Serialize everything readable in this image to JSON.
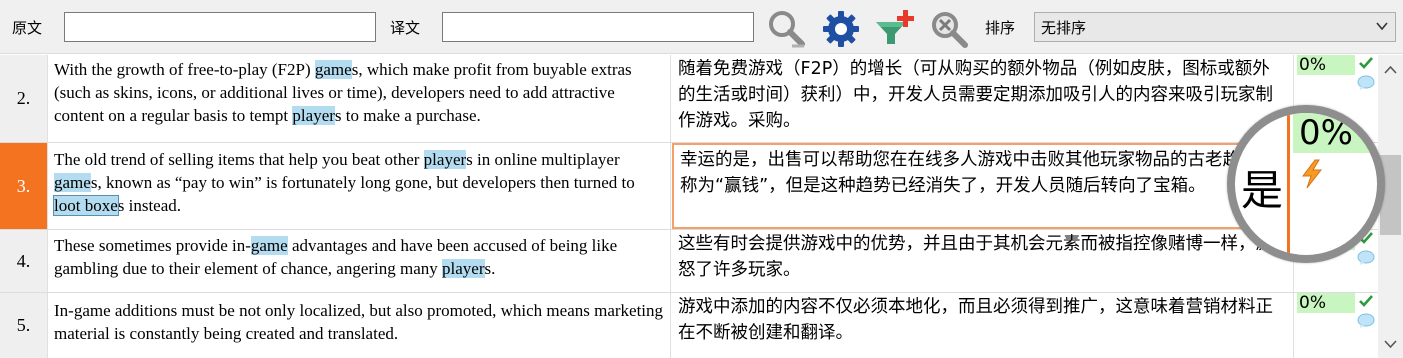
{
  "toolbar": {
    "source_label": "原文",
    "source_value": "",
    "target_label": "译文",
    "target_value": "",
    "sort_label": "排序",
    "sort_value": "无排序",
    "icons": [
      "search-options-icon",
      "settings-gear-icon",
      "add-filter-icon",
      "clear-search-icon"
    ],
    "accent_blue": "#1f4fa3",
    "accent_red": "#e8392b"
  },
  "rows": [
    {
      "number": "2.",
      "active": false,
      "source": [
        {
          "t": "With the growth of free-to-play (F2P) "
        },
        {
          "t": "game",
          "h": true
        },
        {
          "t": "s, which make profit from buyable extras (such as skins, icons, or additional lives or time), developers need to add attractive content on a regular basis to tempt "
        },
        {
          "t": "player",
          "h": true
        },
        {
          "t": "s to make a purchase."
        }
      ],
      "target": "随着免费游戏（F2P）的增长（可从购买的额外物品（例如皮肤，图标或额外的生活或时间）获利）中，开发人员需要定期添加吸引人的内容来吸引玩家制作游戏。采购。",
      "percent": "0%"
    },
    {
      "number": "3.",
      "active": true,
      "source": [
        {
          "t": "The old trend of selling items that help you beat other "
        },
        {
          "t": "player",
          "h": true
        },
        {
          "t": "s in online multiplayer "
        },
        {
          "t": "game",
          "h": true
        },
        {
          "t": "s, known as “pay to win” is fortunately long gone, but developers then turned to "
        },
        {
          "t": "loot boxe",
          "h": true,
          "box": true
        },
        {
          "t": "s instead."
        }
      ],
      "target": "幸运的是，出售可以帮助您在在线多人游戏中击败其他玩家物品的古老趋势被称为“赢钱”，但是这种趋势已经消失了，开发人员随后转向了宝箱。",
      "percent": "0%"
    },
    {
      "number": "4.",
      "active": false,
      "source": [
        {
          "t": "These sometimes provide in-"
        },
        {
          "t": "game",
          "h": true
        },
        {
          "t": " advantages and have been accused of being like gambling due to their element of chance, angering many "
        },
        {
          "t": "player",
          "h": true
        },
        {
          "t": "s."
        }
      ],
      "target": "这些有时会提供游戏中的优势，并且由于其机会元素而被指控像赌博一样，激怒了许多玩家。",
      "percent": "0%"
    },
    {
      "number": "5.",
      "active": false,
      "source": [
        {
          "t": "In-game additions must be not only localized, but also promoted, which means marketing material is constantly being created and translated."
        }
      ],
      "target": "游戏中添加的内容不仅必须本地化，而且必须得到推广，这意味着营销材料正在不断被创建和翻译。",
      "percent": "0%"
    }
  ],
  "magnifier": {
    "char": "是",
    "percent": "0%"
  },
  "colors": {
    "active_row": "#f47321",
    "highlight": "#b4dcf0",
    "match_green": "#c8f5c0"
  }
}
